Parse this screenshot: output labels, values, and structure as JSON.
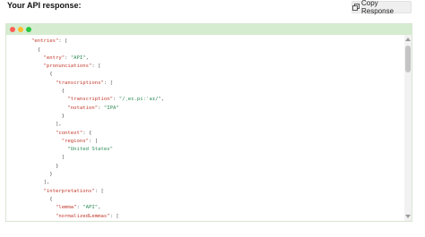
{
  "header": {
    "title": "Your API response:",
    "copy_label": "Copy Response",
    "copy_icon": "copy-icon"
  },
  "window": {
    "dots": [
      "red",
      "yellow",
      "green"
    ],
    "colors": {
      "header_bg": "#d5ecd0",
      "key": "#c0392b",
      "string": "#2e8b57"
    }
  },
  "code_lines": [
    [
      [
        "p",
        "{"
      ]
    ],
    [
      [
        "k",
        "\"entries\""
      ],
      [
        "p",
        ": ["
      ]
    ],
    [
      [
        "p",
        "  {"
      ]
    ],
    [
      [
        "p",
        "    "
      ],
      [
        "k",
        "\"entry\""
      ],
      [
        "p",
        ": "
      ],
      [
        "s",
        "\"API\""
      ],
      [
        "p",
        ","
      ]
    ],
    [
      [
        "p",
        "    "
      ],
      [
        "k",
        "\"pronunciations\""
      ],
      [
        "p",
        ": ["
      ]
    ],
    [
      [
        "p",
        "      {"
      ]
    ],
    [
      [
        "p",
        "        "
      ],
      [
        "k",
        "\"transcriptions\""
      ],
      [
        "p",
        ": ["
      ]
    ],
    [
      [
        "p",
        "          {"
      ]
    ],
    [
      [
        "p",
        "            "
      ],
      [
        "k",
        "\"transcription\""
      ],
      [
        "p",
        ": "
      ],
      [
        "s",
        "\"/ˌeɪ.piːˈaɪ/\""
      ],
      [
        "p",
        ","
      ]
    ],
    [
      [
        "p",
        "            "
      ],
      [
        "k",
        "\"notation\""
      ],
      [
        "p",
        ": "
      ],
      [
        "s",
        "\"IPA\""
      ]
    ],
    [
      [
        "p",
        "          }"
      ]
    ],
    [
      [
        "p",
        "        ],"
      ]
    ],
    [
      [
        "p",
        "        "
      ],
      [
        "k",
        "\"context\""
      ],
      [
        "p",
        ": {"
      ]
    ],
    [
      [
        "p",
        "          "
      ],
      [
        "k",
        "\"regions\""
      ],
      [
        "p",
        ": ["
      ]
    ],
    [
      [
        "p",
        "            "
      ],
      [
        "s",
        "\"United States\""
      ]
    ],
    [
      [
        "p",
        "          ]"
      ]
    ],
    [
      [
        "p",
        "        }"
      ]
    ],
    [
      [
        "p",
        "      }"
      ]
    ],
    [
      [
        "p",
        "    ],"
      ]
    ],
    [
      [
        "p",
        "    "
      ],
      [
        "k",
        "\"interpretations\""
      ],
      [
        "p",
        ": ["
      ]
    ],
    [
      [
        "p",
        "      {"
      ]
    ],
    [
      [
        "p",
        "        "
      ],
      [
        "k",
        "\"lemma\""
      ],
      [
        "p",
        ": "
      ],
      [
        "s",
        "\"API\""
      ],
      [
        "p",
        ","
      ]
    ],
    [
      [
        "p",
        "        "
      ],
      [
        "k",
        "\"normalizedLemmas\""
      ],
      [
        "p",
        ": ["
      ]
    ],
    [
      [
        "p",
        "          {"
      ]
    ]
  ]
}
